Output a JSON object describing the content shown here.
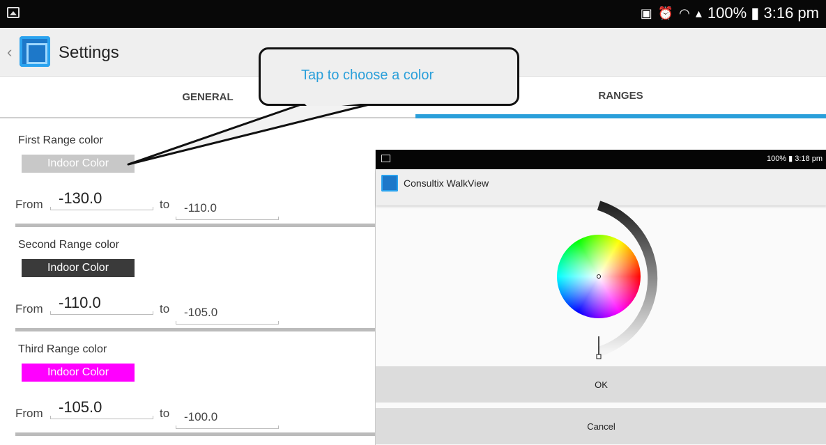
{
  "status": {
    "right_text": "100% ▮ 3:16 pm",
    "icons": [
      "image-icon",
      "battery-icon",
      "alarm-icon",
      "wifi-icon",
      "signal-icon"
    ]
  },
  "appbar": {
    "back": "‹",
    "title": "Settings"
  },
  "tabs": [
    {
      "label": "GENERAL"
    },
    {
      "label": "RANGES"
    }
  ],
  "callout": {
    "text": "Tap to choose a color"
  },
  "ranges": [
    {
      "label": "First Range color",
      "swatch_text": "Indoor Color",
      "swatch_color": "#c8c8c8",
      "swatch_text_color": "#ffffff",
      "from_label": "From",
      "from": "-130.0",
      "to_label": "to",
      "to": "-110.0"
    },
    {
      "label": "Second Range color",
      "swatch_text": "Indoor Color",
      "swatch_color": "#3a3a3a",
      "swatch_text_color": "#ffffff",
      "from_label": "From",
      "from": "-110.0",
      "to_label": "to",
      "to": "-105.0"
    },
    {
      "label": "Third Range color",
      "swatch_text": "Indoor Color",
      "swatch_color": "#ff00ff",
      "swatch_text_color": "#ffffff",
      "from_label": "From",
      "from": "-105.0",
      "to_label": "to",
      "to": "-100.0"
    }
  ],
  "dialog": {
    "status_right": "100% ▮ 3:18 pm",
    "title": "Consultix WalkView",
    "ok_label": "OK",
    "cancel_label": "Cancel"
  },
  "colors": {
    "accent": "#2a9fda",
    "dark": "#080808"
  }
}
